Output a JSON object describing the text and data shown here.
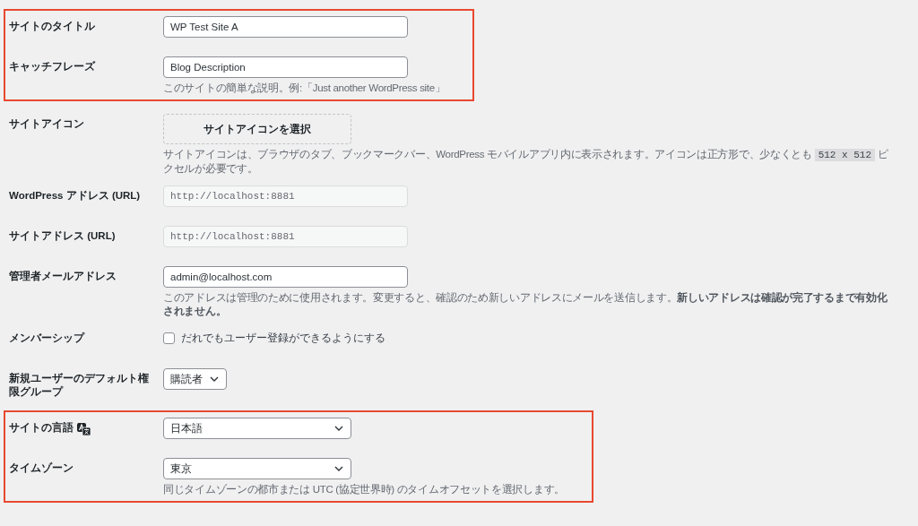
{
  "sections": [
    {
      "highlighted": true,
      "rows": [
        {
          "kind": "text",
          "label": "サイトのタイトル",
          "value": "WP Test Site A"
        },
        {
          "kind": "text",
          "label": "キャッチフレーズ",
          "value": "Blog Description",
          "description": [
            {
              "kind": "text",
              "text": "このサイトの簡単な説明。例:「Just another WordPress site」"
            }
          ]
        }
      ]
    },
    {
      "highlighted": false,
      "rows": [
        {
          "kind": "button",
          "label": "サイトアイコン",
          "value": "サイトアイコンを選択",
          "description": [
            {
              "kind": "text",
              "text": "サイトアイコンは、ブラウザのタブ、ブックマークバー、WordPress モバイルアプリ内に表示されます。アイコンは正方形で、少なくとも "
            },
            {
              "kind": "code",
              "text": "512 x 512"
            },
            {
              "kind": "text",
              "text": " ピクセルが必要です。"
            }
          ]
        },
        {
          "kind": "readonly",
          "label": "WordPress アドレス (URL)",
          "value": "http://localhost:8881"
        },
        {
          "kind": "readonly",
          "label": "サイトアドレス (URL)",
          "value": "http://localhost:8881"
        },
        {
          "kind": "text",
          "label": "管理者メールアドレス",
          "value": "admin@localhost.com",
          "description": [
            {
              "kind": "text",
              "text": "このアドレスは管理のために使用されます。変更すると、確認のため新しいアドレスにメールを送信します。**新しいアドレスは確認が完了するまで有効化されません。**"
            }
          ]
        },
        {
          "kind": "checkbox",
          "label": "メンバーシップ",
          "value": "だれでもユーザー登録ができるようにする",
          "checked": false
        },
        {
          "kind": "select",
          "label": "新規ユーザーのデフォルト権限グループ",
          "value": "購読者"
        }
      ]
    },
    {
      "highlighted": true,
      "rows": [
        {
          "kind": "select",
          "label": "サイトの言語",
          "label_icon": true,
          "value": "日本語"
        },
        {
          "kind": "select",
          "label": "タイムゾーン",
          "value": "東京",
          "description": [
            {
              "kind": "text",
              "text": "同じタイムゾーンの都市または UTC (協定世界時) のタイムオフセットを選択します。"
            }
          ]
        }
      ]
    }
  ]
}
